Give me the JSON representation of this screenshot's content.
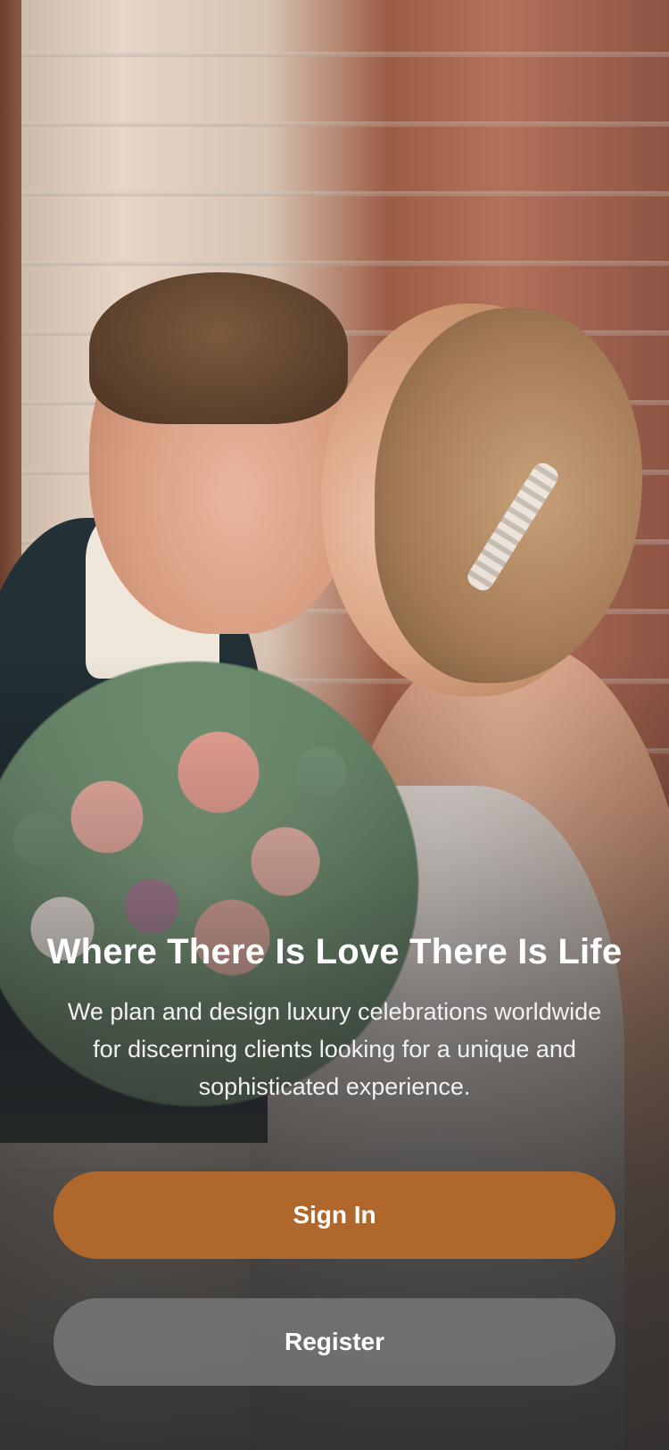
{
  "hero": {
    "headline": "Where There Is Love There Is Life",
    "subtitle": "We plan and design luxury celebrations worldwide for discerning clients looking for a unique and sophisticated experience."
  },
  "actions": {
    "sign_in_label": "Sign In",
    "register_label": "Register"
  },
  "colors": {
    "primary_button": "#b0672c",
    "secondary_button": "#787878",
    "text": "#ffffff",
    "bottom_background": "#2c2c2c"
  }
}
